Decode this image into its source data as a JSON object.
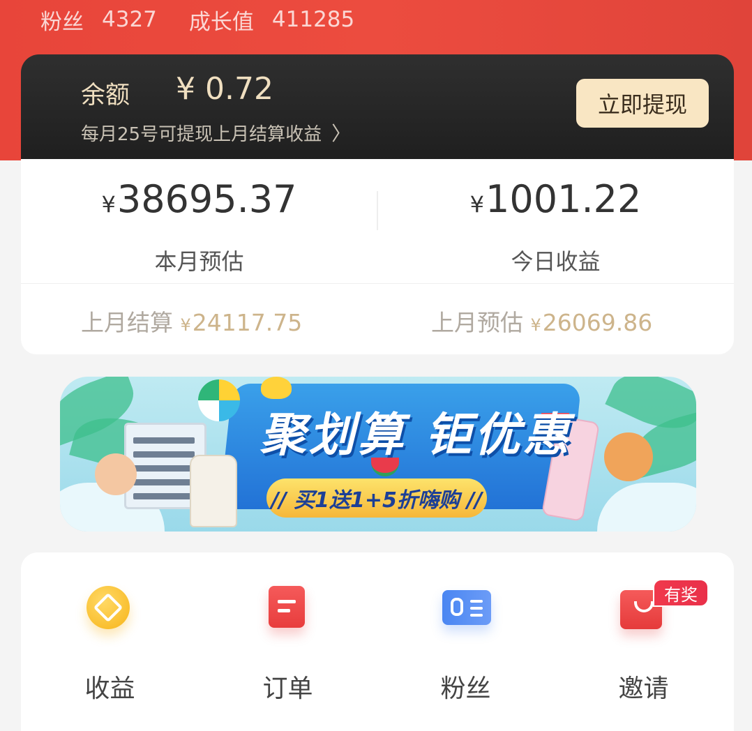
{
  "stats": {
    "fans_label": "粉丝",
    "fans_value": "4327",
    "growth_label": "成长值",
    "growth_value": "411285"
  },
  "balance": {
    "label": "余额",
    "value": "¥ 0.72",
    "hint": "每月25号可提现上月结算收益",
    "hint_icon": "chevron-right-icon",
    "withdraw_button": "立即提现"
  },
  "earnings": {
    "currency": "¥",
    "this_month_amount": "38695.37",
    "this_month_label": "本月预估",
    "today_amount": "1001.22",
    "today_label": "今日收益",
    "last_settle_label": "上月结算",
    "last_settle_amount": "24117.75",
    "last_estimate_label": "上月预估",
    "last_estimate_amount": "26069.86"
  },
  "banner": {
    "title": "聚划算 钜优惠",
    "subtitle": "// 买1送1+5折嗨购 //"
  },
  "menu": {
    "items": [
      {
        "label": "收益",
        "icon": "earnings-icon"
      },
      {
        "label": "订单",
        "icon": "order-icon"
      },
      {
        "label": "粉丝",
        "icon": "fans-icon"
      },
      {
        "label": "邀请",
        "icon": "invite-icon"
      }
    ],
    "invite_badge": "有奖"
  },
  "colors": {
    "header_red": "#e8453a",
    "card_dark": "#222222",
    "gold_text": "#f0dfc0",
    "withdraw_bg": "#f9e6c3",
    "settle_gold": "#cdb48b",
    "badge_red": "#f0394c"
  }
}
